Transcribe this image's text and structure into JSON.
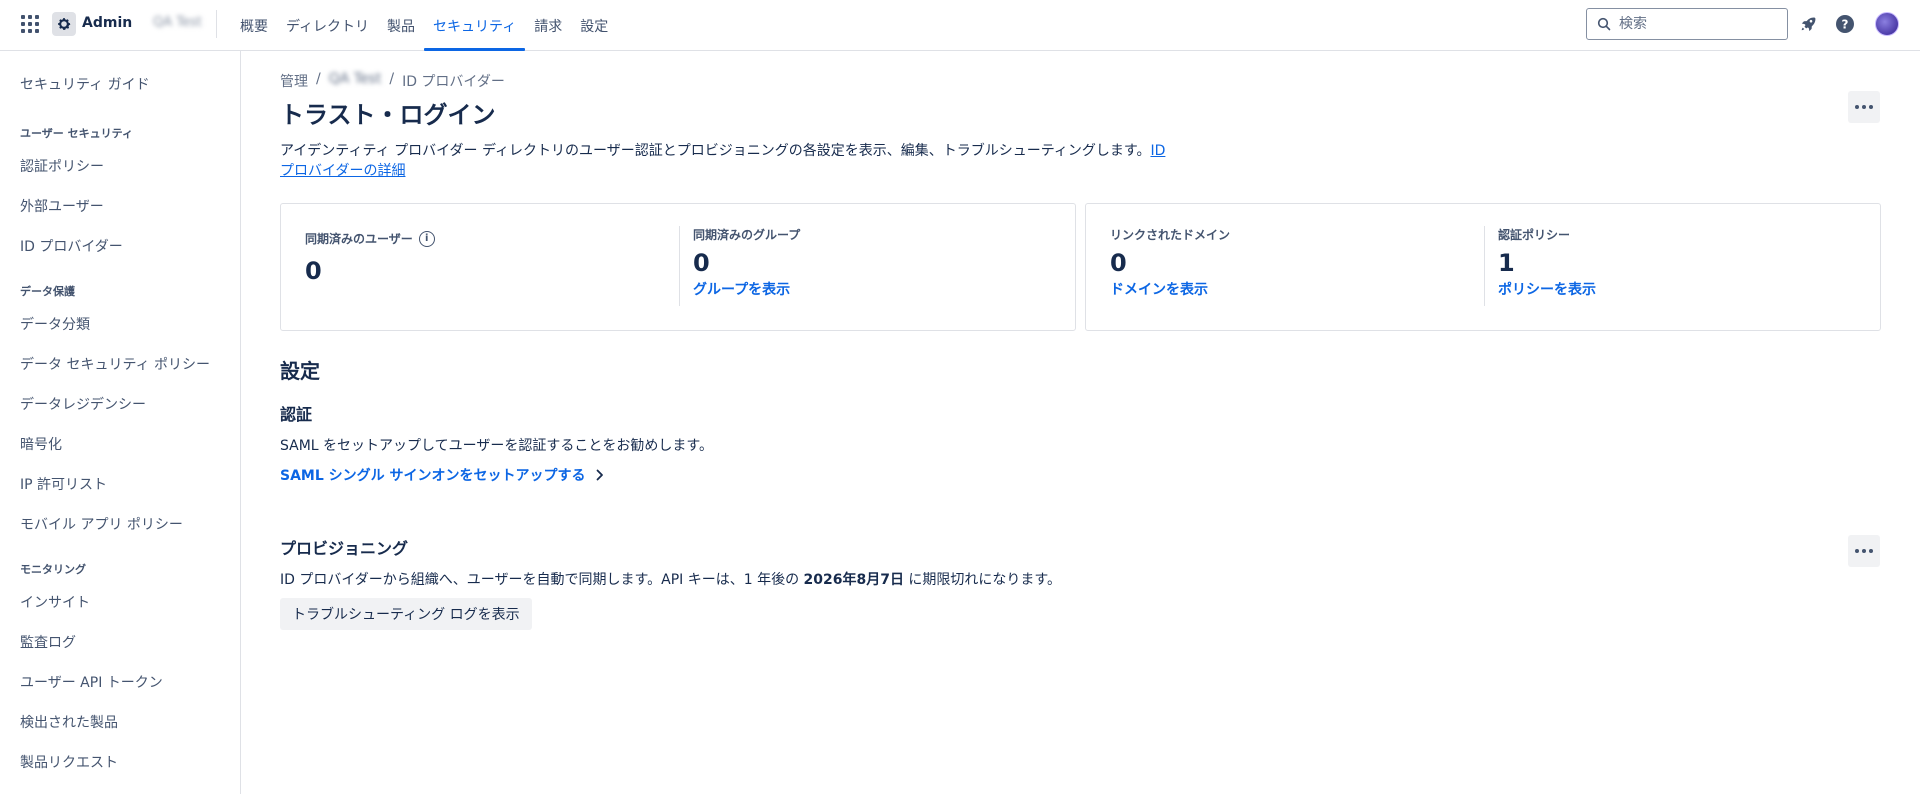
{
  "topnav": {
    "app_name": "Admin",
    "org_name": "QA Test",
    "tabs": [
      {
        "label": "概要"
      },
      {
        "label": "ディレクトリ"
      },
      {
        "label": "製品"
      },
      {
        "label": "セキュリティ"
      },
      {
        "label": "請求"
      },
      {
        "label": "設定"
      }
    ],
    "active_tab": "セキュリティ",
    "search_placeholder": "検索",
    "accent_color": "#0c66e4"
  },
  "sidebar": {
    "top_item": "セキュリティ ガイド",
    "sections": [
      {
        "heading": "ユーザー セキュリティ",
        "items": [
          "認証ポリシー",
          "外部ユーザー",
          "ID プロバイダー"
        ]
      },
      {
        "heading": "データ保護",
        "items": [
          "データ分類",
          "データ セキュリティ ポリシー",
          "データレジデンシー",
          "暗号化",
          "IP 許可リスト",
          "モバイル アプリ ポリシー"
        ]
      },
      {
        "heading": "モニタリング",
        "items": [
          "インサイト",
          "監査ログ",
          "ユーザー API トークン",
          "検出された製品",
          "製品リクエスト"
        ]
      }
    ]
  },
  "breadcrumb": [
    "管理",
    "QA Test",
    "ID プロバイダー"
  ],
  "page": {
    "title": "トラスト・ログイン",
    "description": "アイデンティティ プロバイダー ディレクトリのユーザー認証とプロビジョニングの各設定を表示、編集、トラブルシューティングします。",
    "description_link": "ID プロバイダーの詳細"
  },
  "stats": {
    "synced_users": {
      "label": "同期済みのユーザー",
      "value": "0"
    },
    "synced_groups": {
      "label": "同期済みのグループ",
      "value": "0",
      "link": "グループを表示"
    },
    "linked_domains": {
      "label": "リンクされたドメイン",
      "value": "0",
      "link": "ドメインを表示"
    },
    "auth_policies": {
      "label": "認証ポリシー",
      "value": "1",
      "link": "ポリシーを表示"
    }
  },
  "settings": {
    "heading": "設定",
    "auth": {
      "heading": "認証",
      "text": "SAML をセットアップしてユーザーを認証することをお勧めします。",
      "link": "SAML シングル サインオンをセットアップする"
    },
    "provisioning": {
      "heading": "プロビジョニング",
      "text_before": "ID プロバイダーから組織へ、ユーザーを自動で同期します。API キーは、1 年後の ",
      "expiry_date": "2026年8月7日",
      "text_after": " に期限切れになります。",
      "button": "トラブルシューティング ログを表示"
    }
  }
}
